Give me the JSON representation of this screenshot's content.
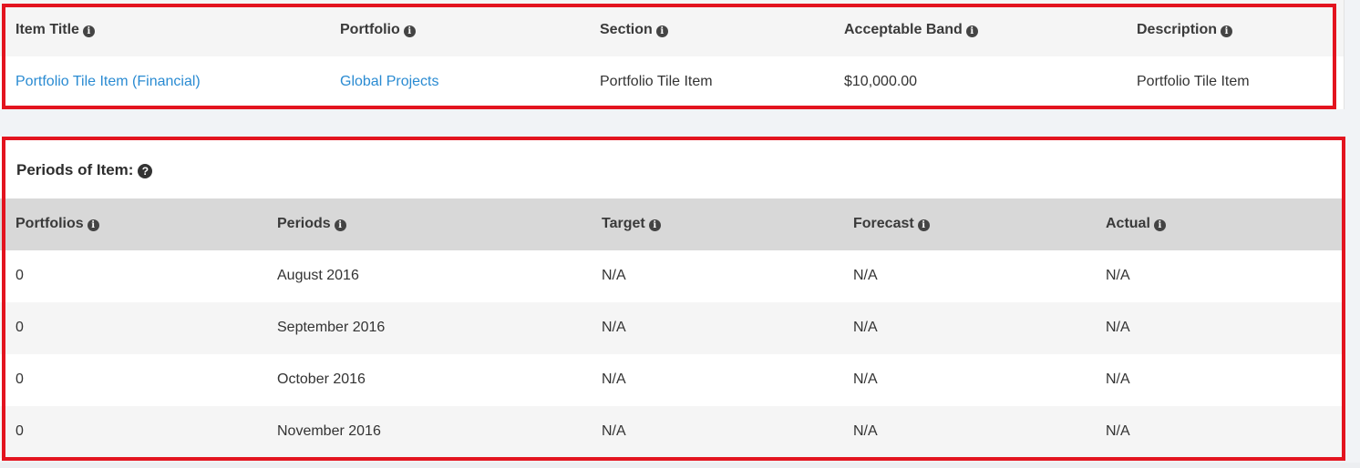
{
  "item_table": {
    "headers": [
      "Item Title",
      "Portfolio",
      "Section",
      "Acceptable Band",
      "Description"
    ],
    "row": {
      "item_title": "Portfolio Tile Item (Financial)",
      "portfolio": "Global Projects",
      "section": "Portfolio Tile Item",
      "acceptable_band": "$10,000.00",
      "description": "Portfolio Tile Item"
    }
  },
  "periods_table": {
    "title": "Periods of Item:",
    "headers": [
      "Portfolios",
      "Periods",
      "Target",
      "Forecast",
      "Actual"
    ],
    "rows": [
      {
        "portfolios": "0",
        "period": "August 2016",
        "target": "N/A",
        "forecast": "N/A",
        "actual": "N/A"
      },
      {
        "portfolios": "0",
        "period": "September 2016",
        "target": "N/A",
        "forecast": "N/A",
        "actual": "N/A"
      },
      {
        "portfolios": "0",
        "period": "October 2016",
        "target": "N/A",
        "forecast": "N/A",
        "actual": "N/A"
      },
      {
        "portfolios": "0",
        "period": "November 2016",
        "target": "N/A",
        "forecast": "N/A",
        "actual": "N/A"
      }
    ]
  },
  "icons": {
    "info": "info-circle-icon",
    "help": "question-circle-icon"
  },
  "colors": {
    "link": "#2a8bd2",
    "highlight_border": "#e3141f",
    "header_bg_top": "#f5f5f5",
    "header_bg_periods": "#d8d8d8"
  }
}
